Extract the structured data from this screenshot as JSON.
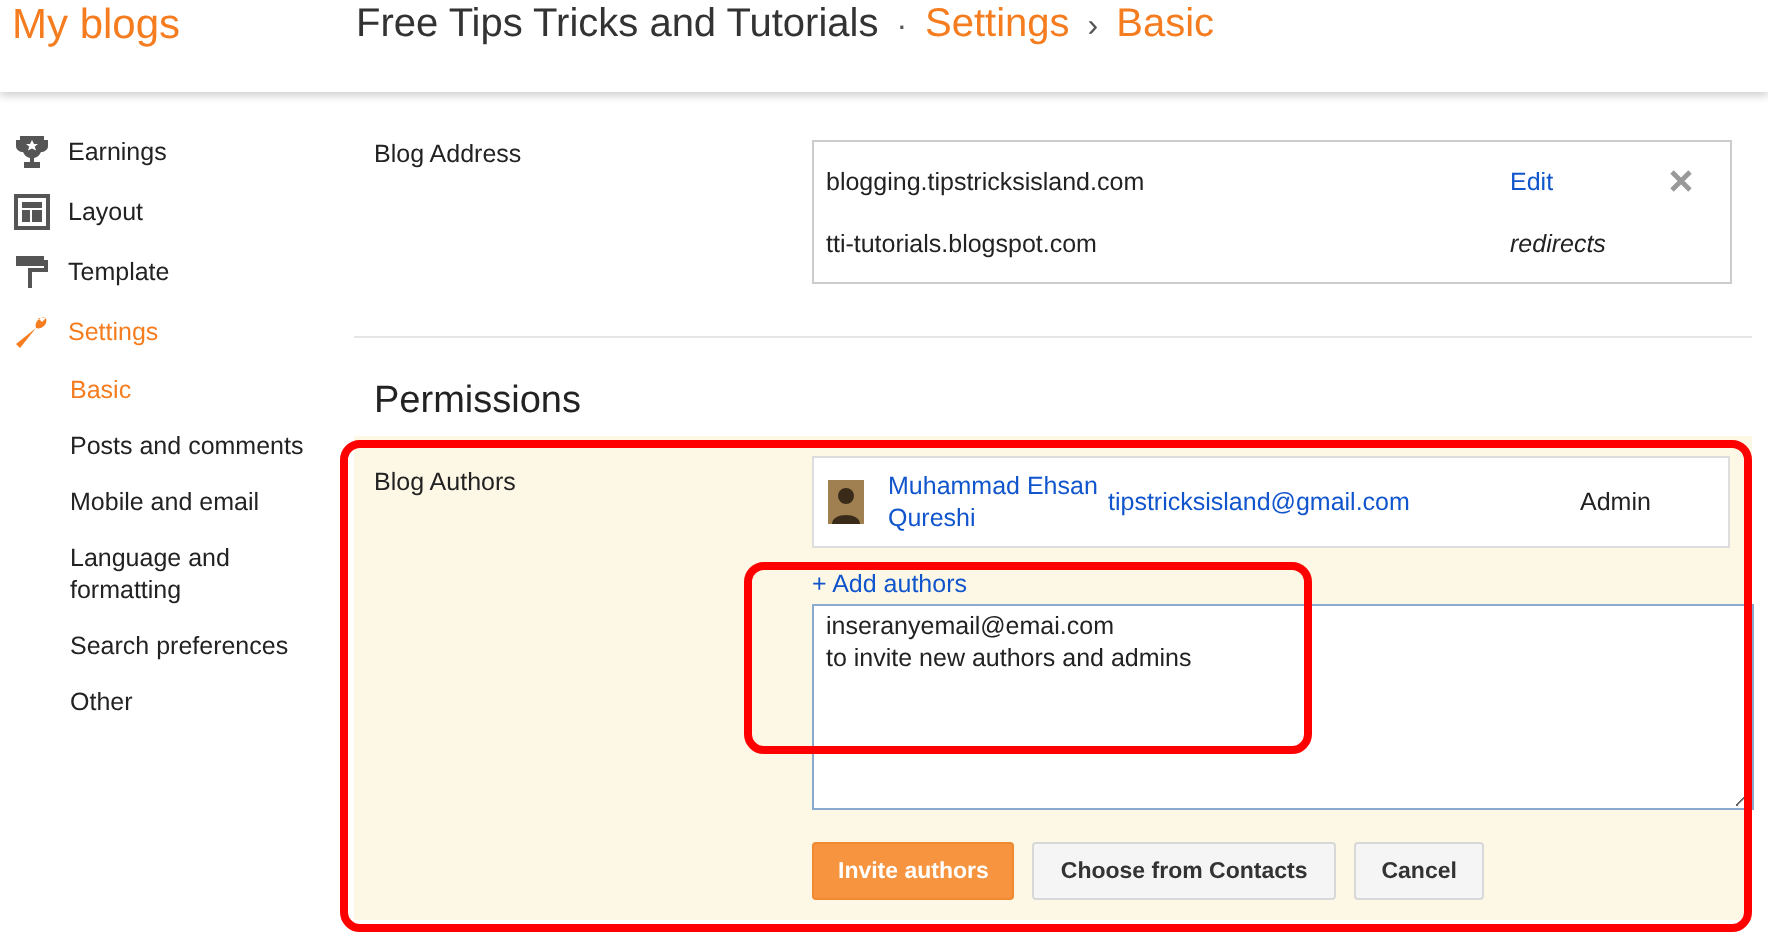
{
  "header": {
    "brand": "My blogs",
    "blog_title": "Free Tips Tricks and Tutorials",
    "separator": "·",
    "breadcrumb_separator": "›",
    "breadcrumb": [
      {
        "label": "Settings"
      },
      {
        "label": "Basic"
      }
    ]
  },
  "sidebar": {
    "items": [
      {
        "label": "Earnings",
        "selected": false
      },
      {
        "label": "Layout",
        "selected": false
      },
      {
        "label": "Template",
        "selected": false
      },
      {
        "label": "Settings",
        "selected": true,
        "children": [
          {
            "label": "Basic",
            "selected": true
          },
          {
            "label": "Posts and comments",
            "selected": false
          },
          {
            "label": "Mobile and email",
            "selected": false
          },
          {
            "label": "Language and formatting",
            "selected": false
          },
          {
            "label": "Search preferences",
            "selected": false
          },
          {
            "label": "Other",
            "selected": false
          }
        ]
      }
    ]
  },
  "publishing": {
    "label": "Blog Address",
    "addresses": [
      {
        "url": "blogging.tipstricksisland.com",
        "action": "Edit",
        "removable": true
      },
      {
        "url": "tti-tutorials.blogspot.com",
        "note": "redirects",
        "removable": false
      }
    ]
  },
  "permissions": {
    "heading": "Permissions",
    "label": "Blog Authors",
    "authors": [
      {
        "name": "Muhammad Ehsan Qureshi",
        "email": "tipstricksisland@gmail.com",
        "role": "Admin"
      }
    ],
    "add_link": "+ Add authors",
    "invite_field": {
      "value": "inseranyemail@emai.com\nto invite new authors and admins"
    },
    "buttons": [
      {
        "label": "Invite authors",
        "kind": "primary"
      },
      {
        "label": "Choose from Contacts",
        "kind": "secondary"
      },
      {
        "label": "Cancel",
        "kind": "secondary"
      }
    ]
  }
}
